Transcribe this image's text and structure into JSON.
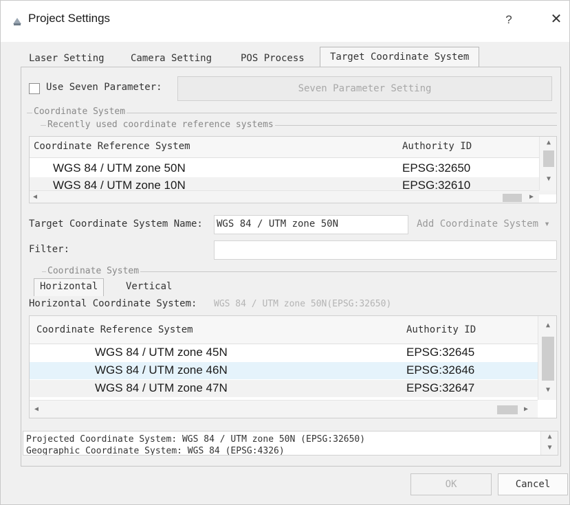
{
  "window": {
    "title": "Project Settings",
    "help": "?",
    "close": "✕"
  },
  "tabs": [
    "Laser Setting",
    "Camera Setting",
    "POS Process",
    "Target Coordinate System"
  ],
  "seven": {
    "checkbox_label": "Use Seven Parameter:",
    "button": "Seven Parameter Setting"
  },
  "coord_group": {
    "title": "Coordinate System",
    "recent_title": "Recently used coordinate reference systems"
  },
  "recent_table": {
    "headers": [
      "Coordinate Reference System",
      "Authority ID"
    ],
    "rows": [
      {
        "crs": "WGS 84 / UTM zone 50N",
        "id": "EPSG:32650"
      },
      {
        "crs": "WGS 84 / UTM zone 10N",
        "id": "EPSG:32610"
      }
    ]
  },
  "target": {
    "label": "Target Coordinate System Name:",
    "value": "WGS 84 / UTM zone 50N",
    "add_button": "Add Coordinate System ▾"
  },
  "filter": {
    "label": "Filter:",
    "value": ""
  },
  "sub_group": {
    "title": "Coordinate System",
    "tabs": [
      "Horizontal",
      "Vertical"
    ]
  },
  "horizontal": {
    "label": "Horizontal Coordinate System:",
    "value": "WGS 84 / UTM zone 50N(EPSG:32650)"
  },
  "crs_table": {
    "headers": [
      "Coordinate Reference System",
      "Authority ID"
    ],
    "rows": [
      {
        "crs": "WGS 84 / UTM zone 45N",
        "id": "EPSG:32645"
      },
      {
        "crs": "WGS 84 / UTM zone 46N",
        "id": "EPSG:32646"
      },
      {
        "crs": "WGS 84 / UTM zone 47N",
        "id": "EPSG:32647"
      }
    ]
  },
  "info": {
    "projected": "Projected Coordinate System: WGS 84 / UTM zone 50N (EPSG:32650)",
    "geographic": "Geographic Coordinate System: WGS 84 (EPSG:4326)"
  },
  "buttons": {
    "ok": "OK",
    "cancel": "Cancel"
  },
  "colors": {
    "selected_row": "#e5f3fb",
    "alt_row": "#f2f2f2"
  }
}
